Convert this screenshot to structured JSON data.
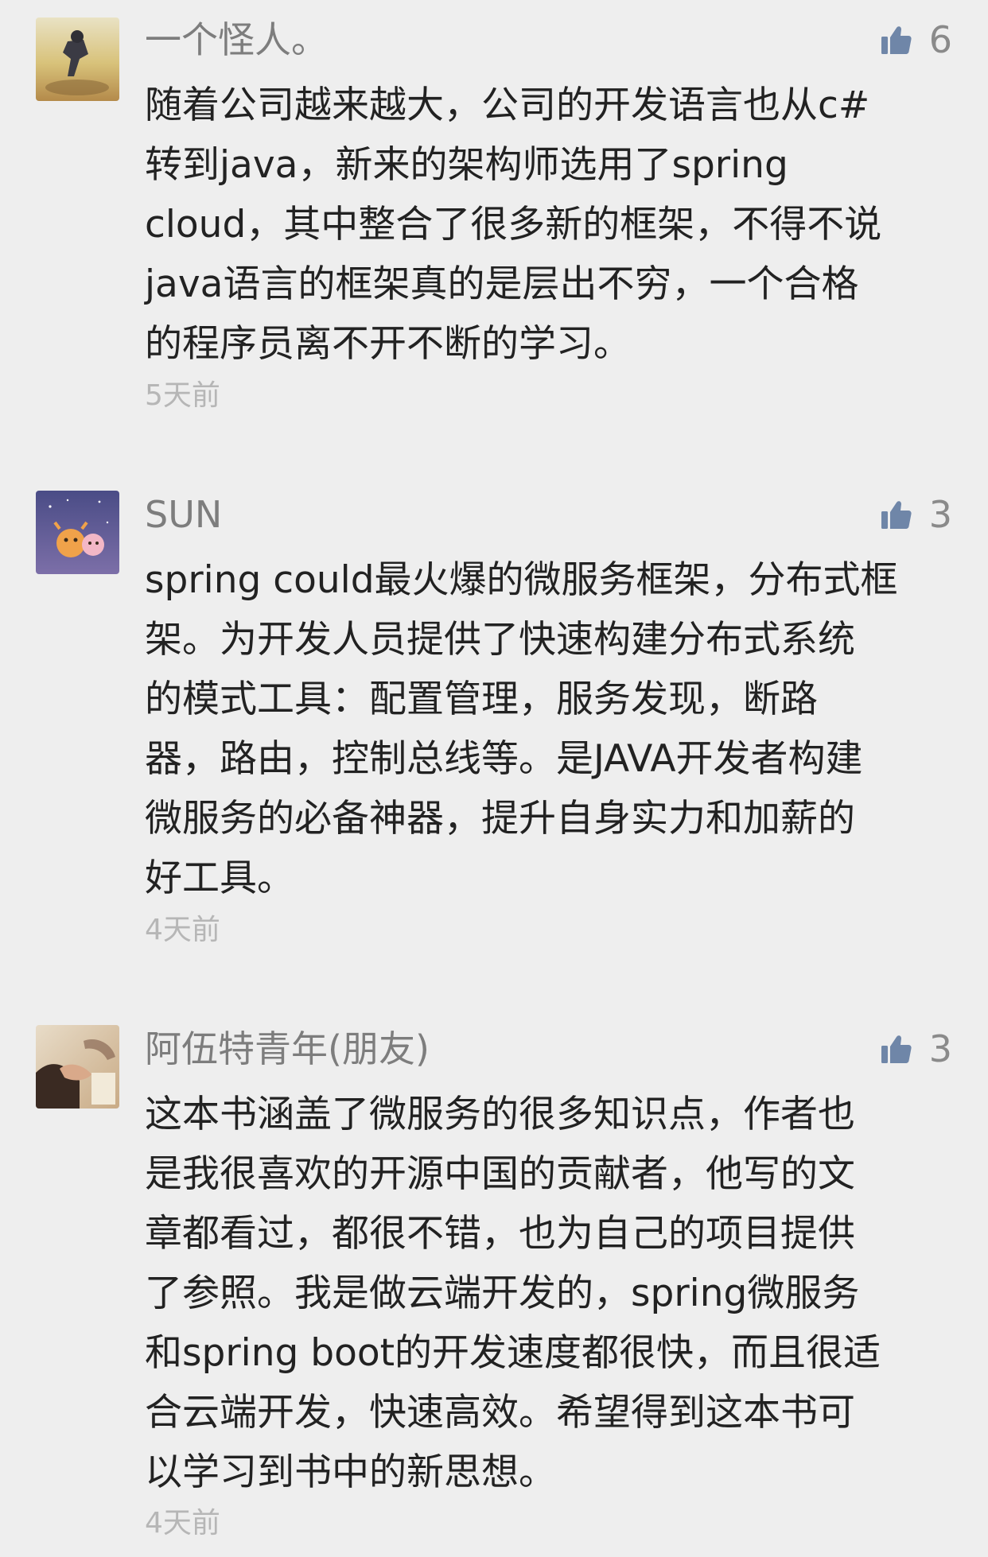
{
  "comments": [
    {
      "nickname": "一个怪人。",
      "likes": "6",
      "lines": [
        "随着公司越来越大，公司的开发语言也从c#",
        "转到java，新来的架构师选用了spring",
        "cloud，其中整合了很多新的框架，不得不说",
        "java语言的框架真的是层出不穷，一个合格",
        "的程序员离不开不断的学习。"
      ],
      "time": "5天前"
    },
    {
      "nickname": "SUN",
      "likes": "3",
      "lines": [
        "spring could最火爆的微服务框架，分布式框",
        "架。为开发人员提供了快速构建分布式系统",
        "的模式工具：配置管理，服务发现，断路",
        "器，路由，控制总线等。是JAVA开发者构建",
        "微服务的必备神器，提升自身实力和加薪的",
        "好工具。"
      ],
      "time": "4天前"
    },
    {
      "nickname": "阿伍特青年(朋友)",
      "likes": "3",
      "lines": [
        "这本书涵盖了微服务的很多知识点，作者也",
        "是我很喜欢的开源中国的贡献者，他写的文",
        "章都看过，都很不错，也为自己的项目提供",
        "了参照。我是做云端开发的，spring微服务",
        "和spring boot的开发速度都很快，而且很适",
        "合云端开发，快速高效。希望得到这本书可",
        "以学习到书中的新思想。"
      ],
      "time": "4天前"
    }
  ],
  "colors": {
    "background": "#eeeeee",
    "nickname": "#7d7d7d",
    "body": "#222222",
    "time": "#b6b6b6",
    "like_icon": "#6f86a8"
  },
  "icons": {
    "like": "thumbs-up-icon"
  }
}
